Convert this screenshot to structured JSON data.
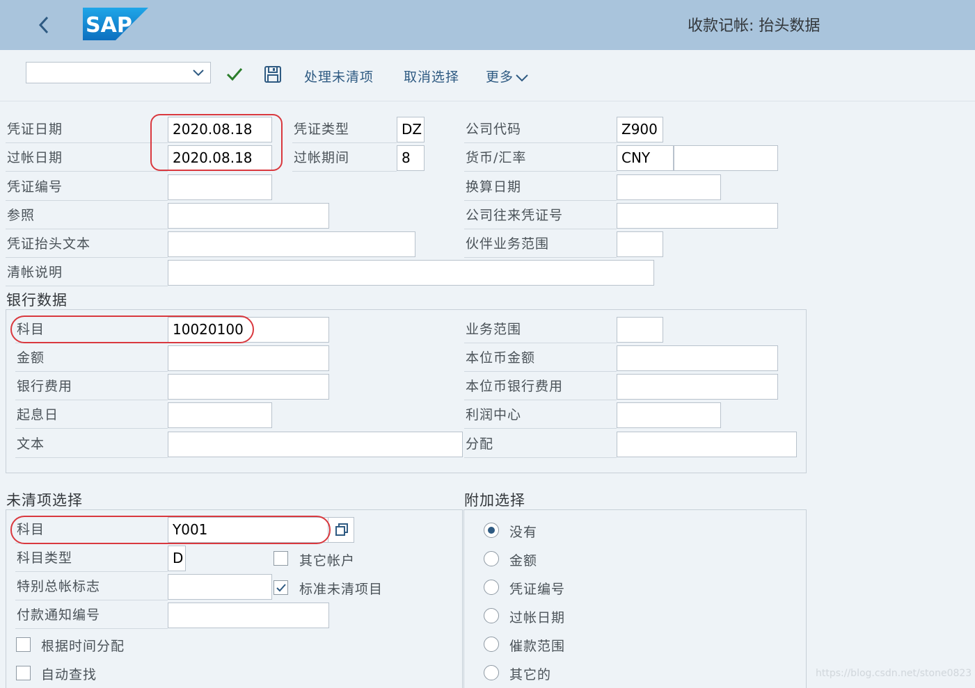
{
  "header": {
    "title": "收款记帐: 抬头数据",
    "logo_text": "SAP"
  },
  "toolbar": {
    "command_value": "",
    "process_open_items": "处理未清项",
    "cancel_selection": "取消选择",
    "more": "更多"
  },
  "header_data": {
    "doc_date": {
      "label": "凭证日期",
      "value": "2020.08.18"
    },
    "posting_date": {
      "label": "过帐日期",
      "value": "2020.08.18"
    },
    "doc_number": {
      "label": "凭证编号",
      "value": ""
    },
    "reference": {
      "label": "参照",
      "value": ""
    },
    "header_text": {
      "label": "凭证抬头文本",
      "value": ""
    },
    "clearing_text": {
      "label": "清帐说明",
      "value": ""
    },
    "doc_type": {
      "label": "凭证类型",
      "value": "DZ"
    },
    "period": {
      "label": "过帐期间",
      "value": "8"
    },
    "company_code": {
      "label": "公司代码",
      "value": "Z900"
    },
    "currency": {
      "label": "货币/汇率",
      "value": "CNY",
      "rate": ""
    },
    "translation_date": {
      "label": "换算日期",
      "value": ""
    },
    "intercompany_doc": {
      "label": "公司往来凭证号",
      "value": ""
    },
    "trading_partner_ba": {
      "label": "伙伴业务范围",
      "value": ""
    }
  },
  "bank_data": {
    "title": "银行数据",
    "account": {
      "label": "科目",
      "value": "10020100"
    },
    "amount": {
      "label": "金额",
      "value": ""
    },
    "bank_charges": {
      "label": "银行费用",
      "value": ""
    },
    "value_date": {
      "label": "起息日",
      "value": ""
    },
    "text": {
      "label": "文本",
      "value": ""
    },
    "business_area": {
      "label": "业务范围",
      "value": ""
    },
    "lc_amount": {
      "label": "本位币金额",
      "value": ""
    },
    "lc_bank_charges": {
      "label": "本位币银行费用",
      "value": ""
    },
    "profit_center": {
      "label": "利润中心",
      "value": ""
    },
    "assignment": {
      "label": "分配",
      "value": ""
    }
  },
  "open_item_selection": {
    "title": "未清项选择",
    "account": {
      "label": "科目",
      "value": "Y001"
    },
    "account_type": {
      "label": "科目类型",
      "value": "D"
    },
    "special_gl": {
      "label": "特别总帐标志",
      "value": ""
    },
    "payment_advice": {
      "label": "付款通知编号",
      "value": ""
    },
    "other_accounts": {
      "label": "其它帐户",
      "checked": false
    },
    "standard_open_items": {
      "label": "标准未清项目",
      "checked": true
    },
    "distribute_by_age": {
      "label": "根据时间分配",
      "checked": false
    },
    "automatic_search": {
      "label": "自动查找",
      "checked": false
    }
  },
  "additional_selection": {
    "title": "附加选择",
    "options": [
      {
        "label": "没有",
        "selected": true
      },
      {
        "label": "金额",
        "selected": false
      },
      {
        "label": "凭证编号",
        "selected": false
      },
      {
        "label": "过帐日期",
        "selected": false
      },
      {
        "label": "催款范围",
        "selected": false
      },
      {
        "label": "其它的",
        "selected": false
      }
    ]
  },
  "watermark": "https://blog.csdn.net/stone0823",
  "colors": {
    "header_bg": "#a9c4dc",
    "body_bg": "#eef3f7",
    "accent_link": "#2e5a82",
    "check_green": "#2b7d2b",
    "highlight_red": "#d9383e",
    "logo_blue": "#1f8ad6"
  }
}
